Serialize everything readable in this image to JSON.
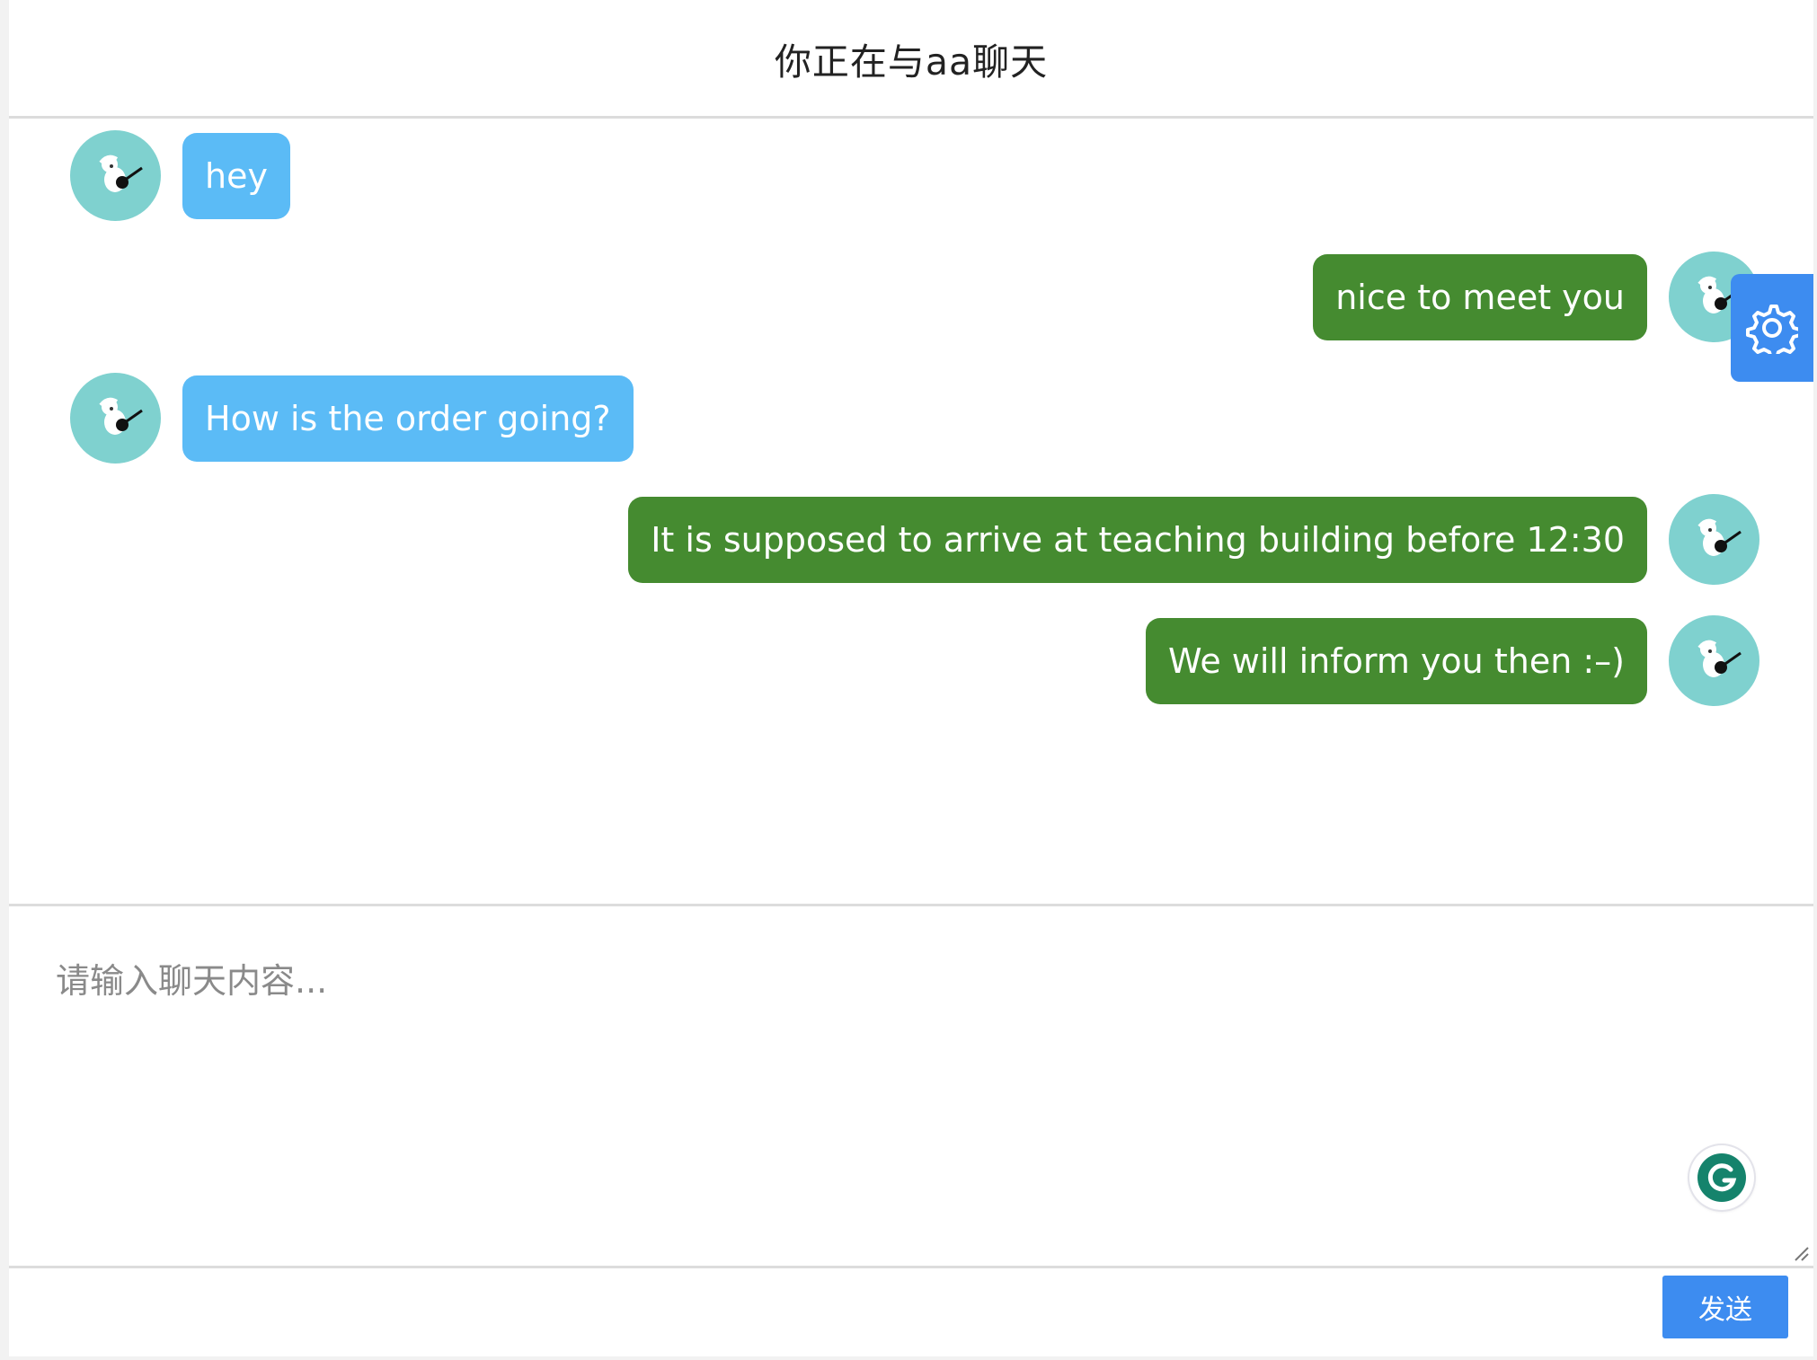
{
  "header": {
    "title": "你正在与aa聊天"
  },
  "messages": [
    {
      "side": "left",
      "text": "hey"
    },
    {
      "side": "right",
      "text": "nice to meet you"
    },
    {
      "side": "left",
      "text": "How is the order going?"
    },
    {
      "side": "right",
      "text": "It is supposed to arrive at teaching building before 12:30"
    },
    {
      "side": "right",
      "text": "We will inform you then :–)"
    }
  ],
  "composer": {
    "placeholder": "请输入聊天内容...",
    "value": ""
  },
  "footer": {
    "send_label": "发送"
  },
  "icons": {
    "avatar": "avatar-character-with-guitar-icon",
    "settings": "gear-icon",
    "grammarly": "grammarly-icon",
    "resize": "resize-handle-icon"
  },
  "colors": {
    "incoming_bubble": "#5bbbf6",
    "outgoing_bubble": "#458b30",
    "avatar_bg": "#7fd1cf",
    "accent": "#3d8cf0"
  }
}
